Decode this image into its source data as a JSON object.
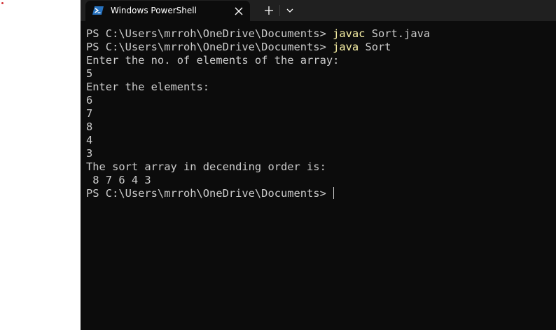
{
  "colors": {
    "terminal_bg": "#0c0c0c",
    "titlebar_bg": "#202020",
    "text": "#cccccc",
    "command": "#f9f1a5",
    "powershell_icon": "#2671be"
  },
  "icons": {
    "tab": "powershell-icon",
    "close": "close-icon",
    "new_tab": "plus-icon",
    "dropdown": "chevron-down-icon"
  },
  "window": {
    "tab_title": "Windows PowerShell"
  },
  "terminal": {
    "line1": {
      "prompt": "PS C:\\Users\\mrroh\\OneDrive\\Documents> ",
      "cmd": "javac",
      "args": " Sort.java"
    },
    "line2": {
      "prompt": "PS C:\\Users\\mrroh\\OneDrive\\Documents> ",
      "cmd": "java",
      "args": " Sort"
    },
    "line3": "Enter the no. of elements of the array:",
    "line4": "5",
    "line5": "Enter the elements:",
    "line6": "6",
    "line7": "7",
    "line8": "8",
    "line9": "4",
    "line10": "3",
    "line11": "The sort array in decending order is:",
    "line12": " 8 7 6 4 3",
    "line13": {
      "prompt": "PS C:\\Users\\mrroh\\OneDrive\\Documents> "
    }
  }
}
